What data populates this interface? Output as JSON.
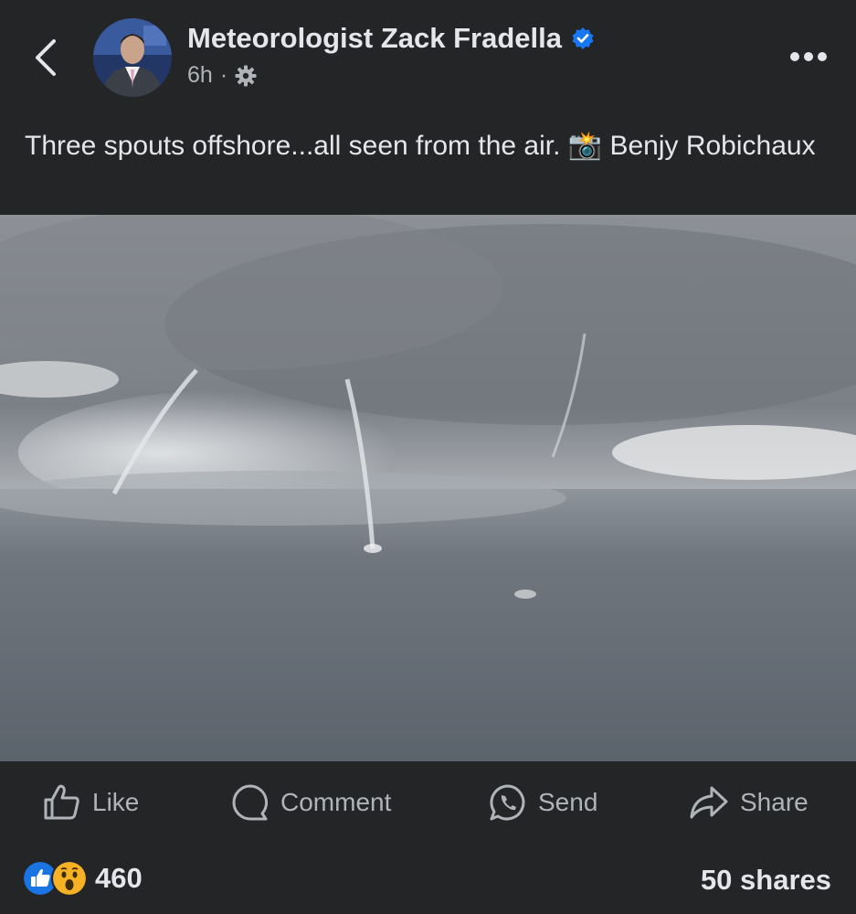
{
  "header": {
    "author_name": "Meteorologist Zack Fradella",
    "time": "6h",
    "separator": "·",
    "verified_icon": "verified-badge-icon",
    "audience_icon": "gear-icon",
    "more_icon": "more-horizontal-icon",
    "back_icon": "chevron-left-icon"
  },
  "post": {
    "caption_text": "Three spouts offshore...all seen from the air. 📸 Benjy Robichaux"
  },
  "actions": {
    "like_label": "Like",
    "comment_label": "Comment",
    "send_label": "Send",
    "share_label": "Share"
  },
  "footer": {
    "reaction_count": "460",
    "shares_label": "50 shares",
    "reactions": [
      "like-reaction-icon",
      "wow-reaction-icon"
    ]
  },
  "colors": {
    "background": "#242526",
    "primary_text": "#e4e6eb",
    "secondary_text": "#b0b3b8",
    "verified_blue": "#1877f2",
    "like_blue": "#1b74e4",
    "wow_yellow": "#f7b125"
  }
}
